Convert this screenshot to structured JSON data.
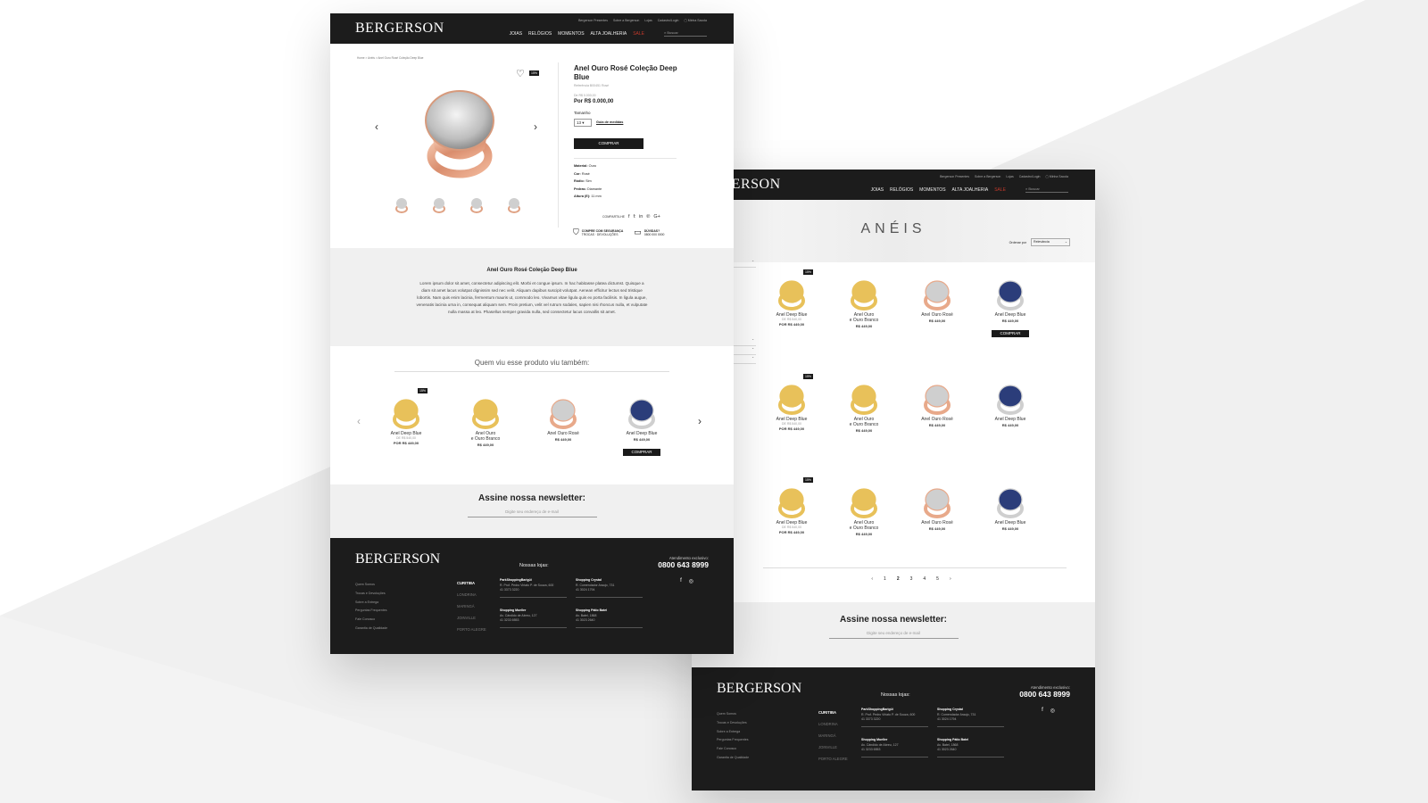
{
  "brand": "BERGERSON",
  "header": {
    "util_links": [
      "Bergerson Presentes",
      "Sobre a Bergerson",
      "Lojas",
      "Cadastro/Login",
      "Minha Sacola"
    ],
    "nav": [
      "JOIAS",
      "RELÓGIOS",
      "MOMENTOS",
      "ALTA JOALHERIA",
      "SALE"
    ],
    "search_placeholder": "Buscar"
  },
  "product": {
    "breadcrumb": "Home  >  Anéis  >  Anel Ouro Rosé Coleção Deep Blue",
    "badge": "15%",
    "title": "Anel Ouro Rosé Coleção Deep Blue",
    "ref": "Referência B00451 Rosé",
    "old_price": "De R$ 0.000,00",
    "price": "Por R$ 0.000,00",
    "size_label": "Tamanho",
    "size_value": "13",
    "size_guide": "Guia de medidas",
    "buy": "COMPRAR",
    "specs": [
      {
        "k": "Material:",
        "v": " Ouro"
      },
      {
        "k": "Cor:",
        "v": " Rosé"
      },
      {
        "k": "Ródio:",
        "v": " Sim"
      },
      {
        "k": "Pedras:",
        "v": " Diamante"
      },
      {
        "k": "Altura (E):",
        "v": " 11 mm"
      }
    ],
    "share_label": "COMPARTILHE",
    "secure": "COMPRE COM SEGURANÇA",
    "secure_sub": "TROCAS · DEVOLUÇÕES",
    "doubts": "DÚVIDAS?",
    "doubts_phone": "0800 000 0000"
  },
  "description": {
    "title": "Anel Ouro Rosé Coleção Deep Blue",
    "text": "Lorem ipsum dolor sit amet, consectetur adipiscing elit. Morbi et congue ipsum. In hac habitasse platea dictumst. Quisque a diam sit amet lacus volutpat dignissim sed nec velit. Aliquam dapibus suscipit volutpat. Aenean efficitur lectus sed tristique lobortis. Nam quis enim lacinia, fermentum mauris ut, commodo leo. Vivamus vitae ligula quis ex porta facilisis. In ligula augue, venenatis lacinia urna in, consequat aliquam sem. Proin pretium, velit vel rutrum sodales, sapien nisi rhoncus nulla, et vulputate nulla massa at leo. Phasellus semper gravida nulla, sed consectetur lacus convallis sit amet."
  },
  "related": {
    "title": "Quem viu esse produto viu também:",
    "items": [
      {
        "name": "Anel Deep Blue",
        "old": "DE R$ 540,00",
        "price": "POR R$ 449,00",
        "badge": "15%"
      },
      {
        "name": "Anel Ouro\ne Ouro Branco",
        "old": "",
        "price": "R$ 449,00",
        "badge": ""
      },
      {
        "name": "Anel Ouro Rosé",
        "old": "",
        "price": "R$ 449,00",
        "badge": ""
      },
      {
        "name": "Anel Deep Blue",
        "old": "",
        "price": "R$ 449,00",
        "badge": "",
        "buy": "COMPRAR"
      }
    ]
  },
  "newsletter": {
    "title": "Assine nossa newsletter:",
    "placeholder": "Digite seu endereço de e-mail"
  },
  "footer": {
    "links": [
      "Quem Somos",
      "Trocas e Devoluções",
      "Sobre a Entrega",
      "Perguntas Frequentes",
      "Fale Conosco",
      "Garantia de Qualidade"
    ],
    "stores_title": "Nossas lojas:",
    "cities": [
      "CURITIBA",
      "LONDRINA",
      "MARINGÁ",
      "JOINVILLE",
      "PORTO ALEGRE"
    ],
    "stores": [
      {
        "name": "ParkShoppingBarigüi",
        "addr": "R. Prof. Pedro Viriato P. de Souza, 600",
        "tel": "41 3373 3220"
      },
      {
        "name": "Shopping Crystal",
        "addr": "R. Comendador Araujo, 731",
        "tel": "41 3024 1794"
      },
      {
        "name": "Shopping Mueller",
        "addr": "Av. Cândido de Abreu, 127",
        "tel": "41 3233 6553"
      },
      {
        "name": "Shopping Pátio Batel",
        "addr": "Av. Batel, 1868",
        "tel": "41 3023 2640"
      }
    ],
    "attendance_label": "Atendimento exclusivo:",
    "phone": "0800 643 8999"
  },
  "category": {
    "title": "ANÉIS",
    "sort_label": "Ordenar por",
    "sort_value": "Relevância",
    "products": [
      {
        "name": "Anel Deep Blue",
        "old": "DE R$ 540,00",
        "price": "POR R$ 449,00",
        "badge": "15%"
      },
      {
        "name": "Anel Ouro\ne Ouro Branco",
        "old": "",
        "price": "R$ 449,00",
        "badge": ""
      },
      {
        "name": "Anel Ouro Rosé",
        "old": "",
        "price": "R$ 449,00",
        "badge": ""
      },
      {
        "name": "Anel Deep Blue",
        "old": "",
        "price": "R$ 449,00",
        "badge": "",
        "buy": "COMPRAR"
      },
      {
        "name": "Anel Deep Blue",
        "old": "DE R$ 540,00",
        "price": "POR R$ 449,00",
        "badge": "15%"
      },
      {
        "name": "Anel Ouro\ne Ouro Branco",
        "old": "",
        "price": "R$ 449,00",
        "badge": ""
      },
      {
        "name": "Anel Ouro Rosé",
        "old": "",
        "price": "R$ 449,00",
        "badge": ""
      },
      {
        "name": "Anel Deep Blue",
        "old": "",
        "price": "R$ 449,00",
        "badge": ""
      },
      {
        "name": "Anel Deep Blue",
        "old": "DE R$ 540,00",
        "price": "POR R$ 449,00",
        "badge": "15%"
      },
      {
        "name": "Anel Ouro\ne Ouro Branco",
        "old": "",
        "price": "R$ 449,00",
        "badge": ""
      },
      {
        "name": "Anel Ouro Rosé",
        "old": "",
        "price": "R$ 449,00",
        "badge": ""
      },
      {
        "name": "Anel Deep Blue",
        "old": "",
        "price": "R$ 449,00",
        "badge": ""
      }
    ],
    "pages": [
      "1",
      "2",
      "3",
      "4",
      "5"
    ],
    "current_page": "2"
  },
  "icons": {
    "heart": "heart-icon",
    "prev": "‹",
    "next": "›"
  },
  "colors": {
    "dark": "#1c1c1c",
    "sale": "#c0392b",
    "rose_gold": "#e8a98a",
    "gold": "#e8c15a",
    "silver": "#cfcfcf",
    "sapphire": "#2b3d7a"
  }
}
